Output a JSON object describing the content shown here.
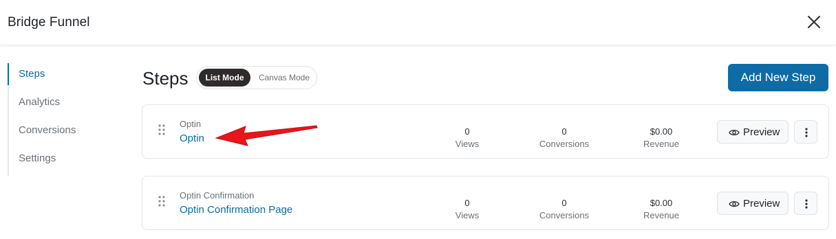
{
  "header": {
    "title": "Bridge Funnel",
    "close_icon": "close-icon"
  },
  "sidebar": {
    "items": [
      {
        "label": "Steps",
        "active": true
      },
      {
        "label": "Analytics",
        "active": false
      },
      {
        "label": "Conversions",
        "active": false
      },
      {
        "label": "Settings",
        "active": false
      }
    ]
  },
  "main": {
    "title": "Steps",
    "modes": {
      "list": "List Mode",
      "canvas": "Canvas Mode",
      "selected": "List Mode"
    },
    "add_button": "Add New Step",
    "steps": [
      {
        "type": "Optin",
        "name": "Optin",
        "views_value": "0",
        "views_label": "Views",
        "conversions_value": "0",
        "conversions_label": "Conversions",
        "revenue_value": "$0.00",
        "revenue_label": "Revenue",
        "preview_label": "Preview"
      },
      {
        "type": "Optin Confirmation",
        "name": "Optin Confirmation Page",
        "views_value": "0",
        "views_label": "Views",
        "conversions_value": "0",
        "conversions_label": "Conversions",
        "revenue_value": "$0.00",
        "revenue_label": "Revenue",
        "preview_label": "Preview"
      }
    ]
  },
  "annotation": {
    "arrow_color": "#e8151b"
  },
  "colors": {
    "accent": "#0e6ba6",
    "link": "#0b6aa2",
    "toggle_active": "#2f2b2b"
  }
}
